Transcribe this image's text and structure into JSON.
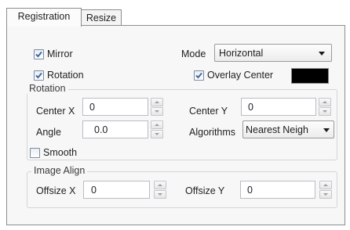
{
  "tabs": [
    {
      "label": "Registration",
      "active": true
    },
    {
      "label": "Resize",
      "active": false
    }
  ],
  "options": {
    "mirror": {
      "label": "Mirror",
      "checked": true
    },
    "rotation": {
      "label": "Rotation",
      "checked": true
    },
    "mode": {
      "label": "Mode",
      "value": "Horizontal"
    },
    "overlay_center": {
      "label": "Overlay Center",
      "checked": true,
      "color": "#000000"
    }
  },
  "rotation_group": {
    "title": "Rotation",
    "center_x": {
      "label": "Center X",
      "value": "0"
    },
    "center_y": {
      "label": "Center Y",
      "value": "0"
    },
    "angle": {
      "label": "Angle",
      "value": "0.0"
    },
    "algorithms": {
      "label": "Algorithms",
      "value": "Nearest Neigh"
    },
    "smooth": {
      "label": "Smooth",
      "checked": false
    }
  },
  "image_align_group": {
    "title": "Image Align",
    "offsize_x": {
      "label": "Offsize X",
      "value": "0"
    },
    "offsize_y": {
      "label": "Offsize Y",
      "value": "0"
    }
  },
  "colors": {
    "panel": "#f7f7f7",
    "border": "#8d8d8d",
    "check": "#3c6aa8"
  }
}
